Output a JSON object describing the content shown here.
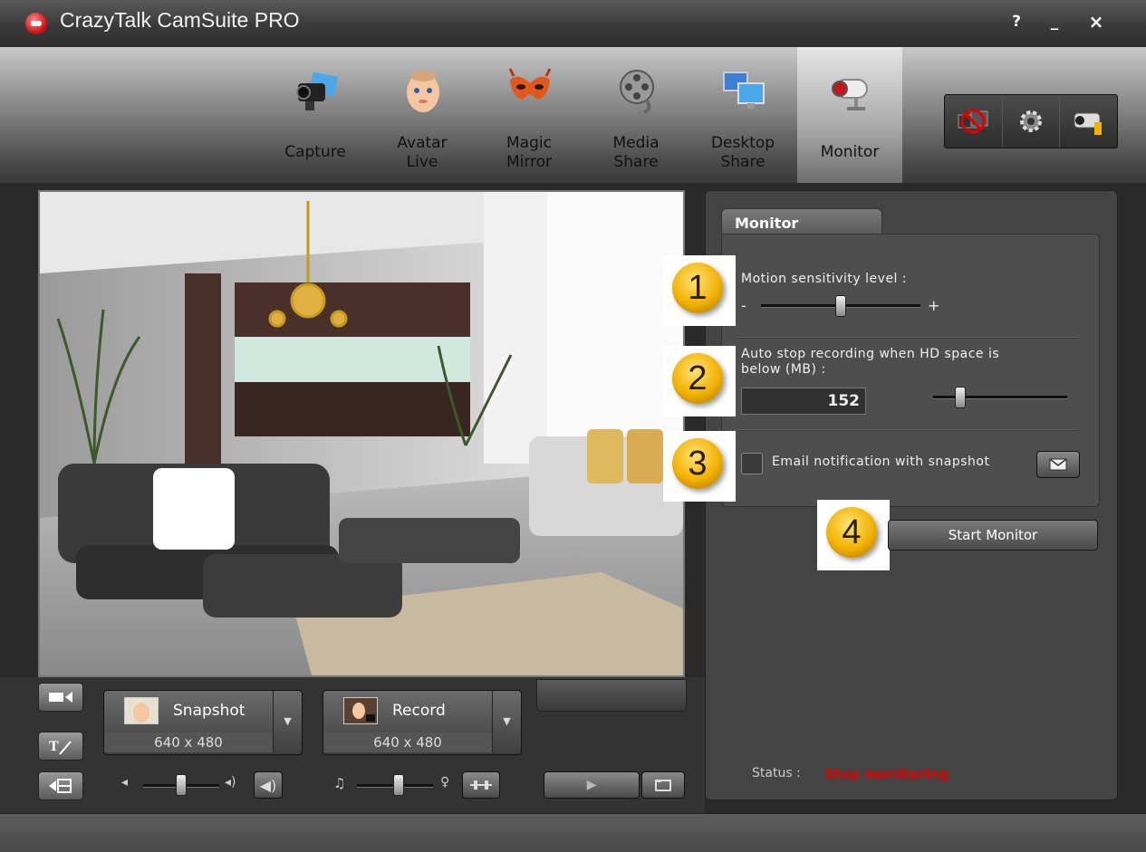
{
  "window": {
    "title": "CrazyTalk CamSuite PRO",
    "help_label": "?",
    "minimize_label": "_",
    "close_label": "×"
  },
  "nav": {
    "tabs": [
      {
        "label": "Capture",
        "icon": "camera-icon"
      },
      {
        "label": "Avatar\nLive",
        "icon": "baby-face-icon"
      },
      {
        "label": "Magic\nMirror",
        "icon": "mask-icon"
      },
      {
        "label": "Media\nShare",
        "icon": "film-reel-icon"
      },
      {
        "label": "Desktop\nShare",
        "icon": "monitors-icon"
      },
      {
        "label": "Monitor",
        "icon": "security-camera-icon",
        "active": true
      }
    ],
    "tools": [
      "no-webcam-icon",
      "gear-icon",
      "camera-settings-icon"
    ]
  },
  "capture": {
    "snapshot_label": "Snapshot",
    "snapshot_resolution": "640 x 480",
    "record_label": "Record",
    "record_resolution": "640 x 480"
  },
  "audio": {
    "volume_level": 0.5,
    "mic_level": 0.55
  },
  "monitor": {
    "tab_label": "Monitor",
    "steps": [
      {
        "number": "1",
        "label": "Motion sensitivity level :"
      },
      {
        "number": "2",
        "label": "Auto stop recording when HD space is\nbelow (MB) :"
      },
      {
        "number": "3",
        "label": "Email notification with snapshot"
      },
      {
        "number": "4",
        "label": "Start Monitor"
      }
    ],
    "sensitivity_minus": "-",
    "sensitivity_plus": "+",
    "sensitivity_level": 0.5,
    "hd_space_value": "152",
    "hd_space_slider_level": 0.2,
    "email_checked": false,
    "status_label": "Status :",
    "status_value": "Stop monitoring"
  },
  "colors": {
    "status_red": "#e00000",
    "badge_gold": "#f2b200"
  }
}
